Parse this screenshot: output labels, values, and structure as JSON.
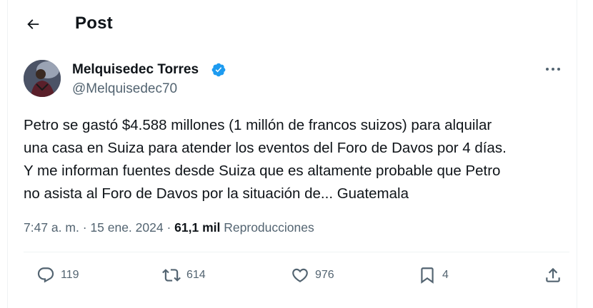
{
  "header": {
    "title": "Post",
    "back_icon": "arrow-left-icon"
  },
  "author": {
    "name": "Melquisedec Torres",
    "handle": "@Melquisedec70",
    "verified": true,
    "verified_color": "#1d9bf0"
  },
  "tweet": {
    "lines": [
      "Petro se gastó $4.588 millones (1 millón de francos suizos) para alquilar",
      "una casa en Suiza para atender los eventos del Foro de Davos por 4 días.",
      "Y me informan fuentes desde Suiza que es altamente probable que Petro",
      "no asista al Foro de Davos por la situación de... Guatemala"
    ]
  },
  "meta": {
    "time": "7:47 a. m.",
    "separator": "·",
    "date": "15 ene. 2024",
    "views_count": "61,1 mil",
    "views_label": "Reproducciones"
  },
  "actions": {
    "replies": "119",
    "reposts": "614",
    "likes": "976",
    "bookmarks": "4"
  },
  "colors": {
    "text": "#0f1419",
    "secondary": "#536471",
    "border": "#eff3f4",
    "accent": "#1d9bf0"
  }
}
